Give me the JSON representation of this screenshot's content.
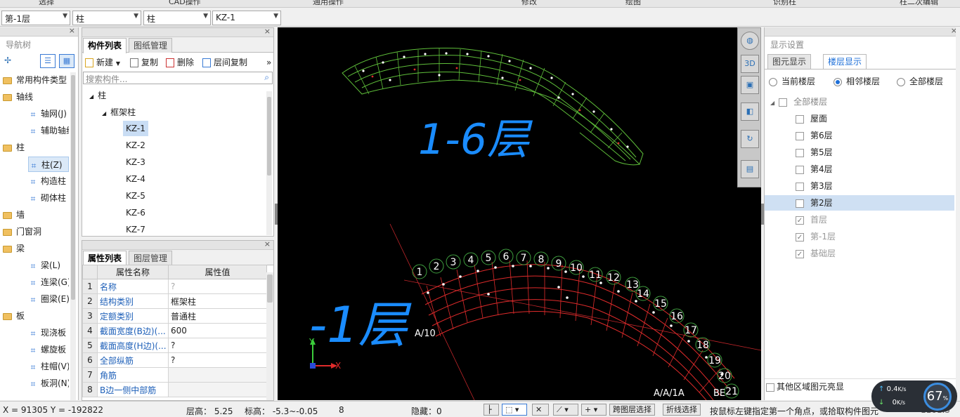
{
  "top_menu": [
    "选择",
    "CAD操作",
    "通用操作",
    "修改",
    "绘图",
    "识别柱",
    "柱二次编辑"
  ],
  "selectors": [
    {
      "value": "第-1层"
    },
    {
      "value": "柱"
    },
    {
      "value": "柱"
    },
    {
      "value": "KZ-1"
    }
  ],
  "nav": {
    "title": "导航树",
    "items": [
      {
        "label": "常用构件类型",
        "type": "folder"
      },
      {
        "label": "轴线",
        "type": "folder"
      },
      {
        "label": "轴网(J)",
        "type": "item",
        "icon": "grid-icon"
      },
      {
        "label": "辅助轴线",
        "type": "item",
        "icon": "aux-grid-icon"
      },
      {
        "label": "柱",
        "type": "folder"
      },
      {
        "label": "柱(Z)",
        "type": "item",
        "icon": "column-icon",
        "selected": true
      },
      {
        "label": "构造柱",
        "type": "item",
        "icon": "structural-column-icon"
      },
      {
        "label": "砌体柱",
        "type": "item",
        "icon": "masonry-column-icon"
      },
      {
        "label": "墙",
        "type": "folder"
      },
      {
        "label": "门窗洞",
        "type": "folder"
      },
      {
        "label": "梁",
        "type": "folder"
      },
      {
        "label": "梁(L)",
        "type": "item",
        "icon": "beam-icon"
      },
      {
        "label": "连梁(G)",
        "type": "item",
        "icon": "link-beam-icon"
      },
      {
        "label": "圈梁(E)",
        "type": "item",
        "icon": "ring-beam-icon"
      },
      {
        "label": "板",
        "type": "folder"
      },
      {
        "label": "现浇板",
        "type": "item",
        "icon": "slab-icon"
      },
      {
        "label": "螺旋板",
        "type": "item",
        "icon": "spiral-slab-icon"
      },
      {
        "label": "柱帽(V)",
        "type": "item",
        "icon": "column-cap-icon"
      },
      {
        "label": "板洞(N)",
        "type": "item",
        "icon": "slab-hole-icon"
      }
    ]
  },
  "component_list": {
    "tabs": [
      "构件列表",
      "图纸管理"
    ],
    "toolbar": {
      "new": "新建",
      "copy": "复制",
      "delete": "删除",
      "layer_copy": "层间复制",
      "more": "»"
    },
    "search_placeholder": "搜索构件...",
    "tree_root": "柱",
    "tree_group": "框架柱",
    "items": [
      "KZ-1",
      "KZ-2",
      "KZ-3",
      "KZ-4",
      "KZ-5",
      "KZ-6",
      "KZ-7"
    ],
    "selected": "KZ-1"
  },
  "properties": {
    "tabs": [
      "属性列表",
      "图层管理"
    ],
    "header": {
      "name": "属性名称",
      "value": "属性值"
    },
    "rows": [
      {
        "no": "1",
        "name": "名称",
        "value": "?"
      },
      {
        "no": "2",
        "name": "结构类别",
        "value": "框架柱"
      },
      {
        "no": "3",
        "name": "定额类别",
        "value": "普通柱"
      },
      {
        "no": "4",
        "name": "截面宽度(B边)(...",
        "value": "600"
      },
      {
        "no": "5",
        "name": "截面高度(H边)(...",
        "value": "?"
      },
      {
        "no": "6",
        "name": "全部纵筋",
        "value": "?"
      },
      {
        "no": "7",
        "name": "角筋",
        "value": ""
      },
      {
        "no": "8",
        "name": "B边一侧中部筋",
        "value": ""
      }
    ]
  },
  "canvas": {
    "annotation_top": "1-6层",
    "annotation_bottom": "-1层",
    "axis_x": "X",
    "axis_y": "Y",
    "bottom_labels": "A/A/1A",
    "bottom_right_labels": "BE",
    "left_label": "A/10",
    "grid_numbers": [
      "1",
      "2",
      "3",
      "4",
      "5",
      "6",
      "7",
      "8",
      "9",
      "10",
      "11",
      "12",
      "13",
      "14",
      "15",
      "16",
      "17",
      "18",
      "19",
      "20",
      "21"
    ]
  },
  "view_toolbar": [
    "globe-icon",
    "3d-view-icon",
    "box-view-icon",
    "cube-view-icon",
    "rotate-icon",
    "layer-view-icon"
  ],
  "display_settings": {
    "title": "显示设置",
    "tabs": [
      "图元显示",
      "楼层显示"
    ],
    "radios": [
      {
        "label": "当前楼层",
        "checked": false
      },
      {
        "label": "相邻楼层",
        "checked": true
      },
      {
        "label": "全部楼层",
        "checked": false
      }
    ],
    "all_layers": "全部楼层",
    "layers": [
      {
        "label": "屋面",
        "checked": false,
        "enabled": true
      },
      {
        "label": "第6层",
        "checked": false,
        "enabled": true
      },
      {
        "label": "第5层",
        "checked": false,
        "enabled": true
      },
      {
        "label": "第4层",
        "checked": false,
        "enabled": true
      },
      {
        "label": "第3层",
        "checked": false,
        "enabled": true
      },
      {
        "label": "第2层",
        "checked": false,
        "enabled": true,
        "highlight": true
      },
      {
        "label": "首层",
        "checked": true,
        "enabled": false
      },
      {
        "label": "第-1层",
        "checked": true,
        "enabled": false
      },
      {
        "label": "基础层",
        "checked": true,
        "enabled": false
      }
    ],
    "other_region": "其他区域图元亮显"
  },
  "status": {
    "coords": "X = 91305 Y = -192822",
    "floor_height": "层高： 5.25",
    "elevation": "标高： -5.3~-0.05",
    "count": "8",
    "hidden": "隐藏：0",
    "btn_cross": "跨图层选择",
    "btn_polyline": "折线选择",
    "hint": "按鼠标左键指定第一个角点，或拾取构件图元",
    "tail": "1161.5"
  },
  "speed": {
    "up": "0.4",
    "up_unit": "K/s",
    "down": "0",
    "down_unit": "K/s",
    "percent": "67",
    "percent_unit": "%"
  },
  "colors": {
    "cad_green": "#5fbf3a",
    "cad_red": "#e02b2b",
    "annotation_blue": "#1a8cff",
    "highlight": "#cfe0f3",
    "link": "#1d5fb8"
  }
}
